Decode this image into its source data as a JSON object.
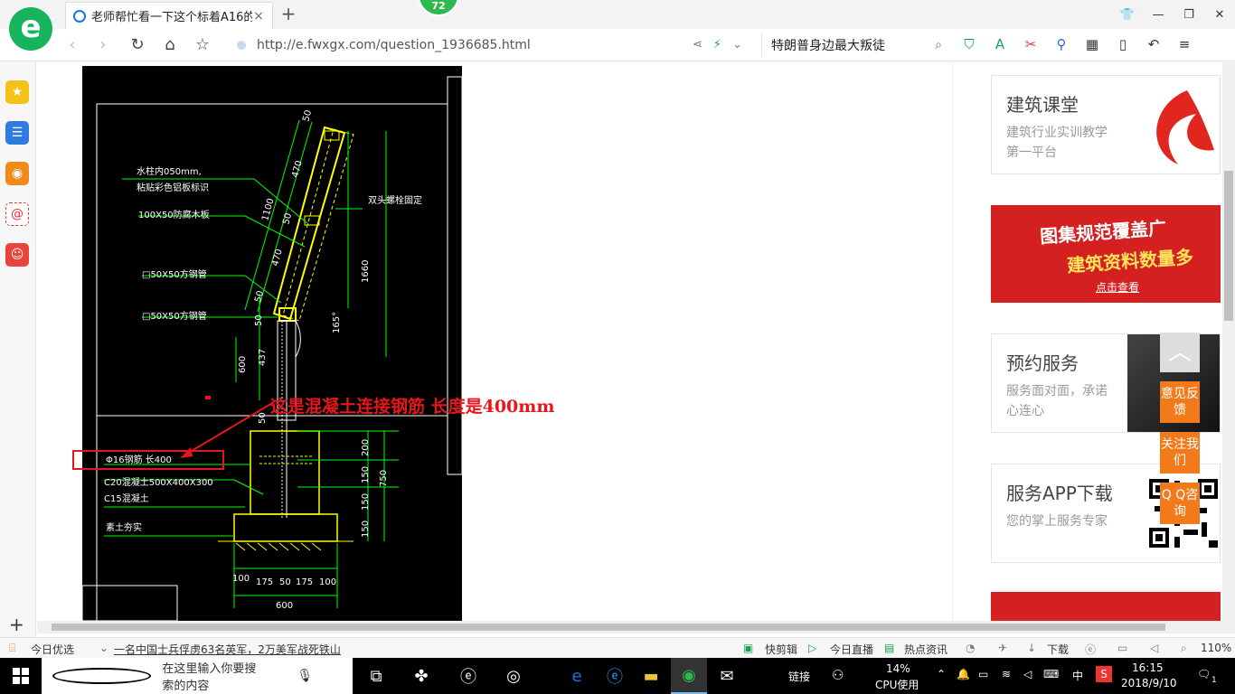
{
  "browser": {
    "tab_title": "老师帮忙看一下这个标着A16的钢",
    "tab_close": "×",
    "new_tab": "+",
    "badge": "72",
    "url": "http://e.fwxgx.com/question_1936685.html",
    "search_text": "特朗普身边最大叛徒"
  },
  "cad": {
    "labels": {
      "l1": "水柱内050mm,",
      "l2": "粘贴彩色铝板标识",
      "l3": "100X50防腐木板",
      "l4": "□50X50方钢管",
      "l5": "□50X50方钢管",
      "l6": "双头螺栓固定",
      "l7": "Φ16钢筋 长400",
      "l8": "C20混凝土500X400X300",
      "l9": "C15混凝土",
      "l10": "素土夯实"
    },
    "dims": {
      "d50a": "50",
      "d470a": "470",
      "d1100": "1100",
      "d50b": "50",
      "d470b": "470",
      "d50c": "50",
      "d50d": "50",
      "d600v": "600",
      "d437": "437",
      "d50e": "50",
      "d1660": "1660",
      "d165": "165°",
      "d200": "200",
      "d150a": "150",
      "d150b": "150",
      "d150c": "150",
      "d750": "750",
      "d100a": "100",
      "d175a": "175",
      "d50f": "50",
      "d175b": "175",
      "d100b": "100",
      "d600h": "600"
    },
    "annotation": "这是混凝土连接钢筋 长度是400mm"
  },
  "sidebar_right": {
    "card1_title": "建筑课堂",
    "card1_sub": "建筑行业实训教学第一平台",
    "banner1_line1": "图集规范覆盖广",
    "banner1_line2": "建筑资料数量多",
    "banner1_link": "点击查看",
    "card2_title": "预约服务",
    "card2_sub": "服务面对面，承诺心连心",
    "card3_title": "服务APP下载",
    "card3_sub": "您的掌上服务专家"
  },
  "float_bar": {
    "feedback": "意见反馈",
    "follow": "关注我们",
    "qq": "Q Q咨询"
  },
  "statusbar": {
    "today": "今日优选",
    "news": "一名中国士兵俘虏63名英军，2万美军战死铁山",
    "clip": "快剪辑",
    "live": "今日直播",
    "hot": "热点资讯",
    "download": "下载",
    "zoom": "110%"
  },
  "taskbar": {
    "search_placeholder": "在这里输入你要搜索的内容",
    "link": "链接",
    "cpu_pct": "14%",
    "cpu_label": "CPU使用",
    "ime": "中",
    "time": "16:15",
    "date": "2018/9/10",
    "notif": "1"
  },
  "colors": {
    "accent_green": "#16b45c",
    "annotation_red": "#e6161b",
    "cad_yellow": "#ffff00",
    "cad_green": "#00ff00",
    "float_orange": "#f27a1a"
  }
}
